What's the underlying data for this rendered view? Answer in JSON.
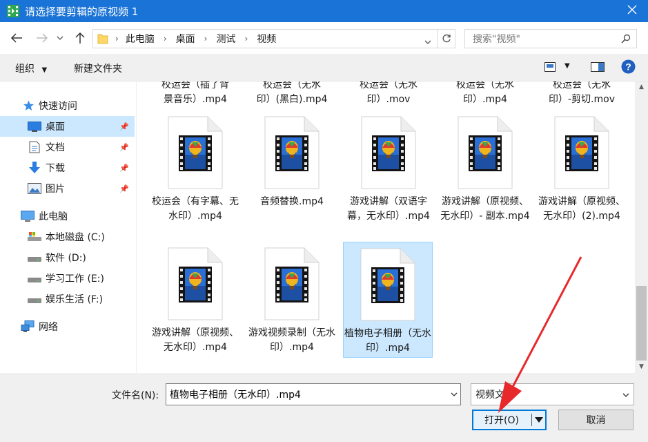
{
  "window": {
    "title": "请选择要剪辑的原视频 1",
    "app_icon": "film-app-icon",
    "close_icon": "close-icon"
  },
  "address": {
    "breadcrumbs": [
      "此电脑",
      "桌面",
      "测试",
      "视频"
    ],
    "search_placeholder": "搜索\"视频\""
  },
  "toolbar": {
    "organize_label": "组织",
    "new_folder_label": "新建文件夹"
  },
  "sidebar": {
    "quick_access": "快速访问",
    "pinned": [
      {
        "label": "桌面",
        "icon": "desktop-icon"
      },
      {
        "label": "文档",
        "icon": "documents-icon"
      },
      {
        "label": "下载",
        "icon": "download-icon"
      },
      {
        "label": "图片",
        "icon": "pictures-icon"
      }
    ],
    "this_pc": "此电脑",
    "drives": [
      {
        "label": "本地磁盘 (C:)",
        "icon": "system-drive-icon"
      },
      {
        "label": "软件 (D:)",
        "icon": "drive-icon"
      },
      {
        "label": "学习工作 (E:)",
        "icon": "drive-icon"
      },
      {
        "label": "娱乐生活 (F:)",
        "icon": "drive-icon"
      }
    ],
    "network": "网络"
  },
  "files": {
    "partial_row": [
      {
        "line1": "校运会（插了背",
        "line2": "景音乐）.mp4"
      },
      {
        "line1": "校运会（无水",
        "line2": "印）(黑白).mp4"
      },
      {
        "line1": "校运会（无水",
        "line2": "印）.mov"
      },
      {
        "line1": "校运会（无水",
        "line2": "印）.mp4"
      },
      {
        "line1": "校运会（无水",
        "line2": "印）-剪切.mov"
      }
    ],
    "row2": [
      {
        "name": "校运会（有字幕、无水印）.mp4"
      },
      {
        "name": "音频替换.mp4"
      },
      {
        "name": "游戏讲解（双语字幕，无水印）.mp4"
      },
      {
        "name": "游戏讲解（原视频、无水印）- 副本.mp4"
      },
      {
        "name": "游戏讲解（原视频、无水印）(2).mp4"
      }
    ],
    "row3": [
      {
        "name": "游戏讲解（原视频、无水印）.mp4"
      },
      {
        "name": "游戏视频录制（无水印）.mp4"
      },
      {
        "name": "植物电子相册（无水印）.mp4"
      }
    ],
    "selected_index": 2
  },
  "bottom": {
    "filename_label": "文件名(N):",
    "filename_value": "植物电子相册（无水印）.mp4",
    "filetype_value": "视频文件",
    "open_label": "打开(O)",
    "cancel_label": "取消"
  },
  "colors": {
    "title_bar": "#1a73d6",
    "selection": "#cce8ff",
    "annotation_arrow": "#e8292c"
  }
}
